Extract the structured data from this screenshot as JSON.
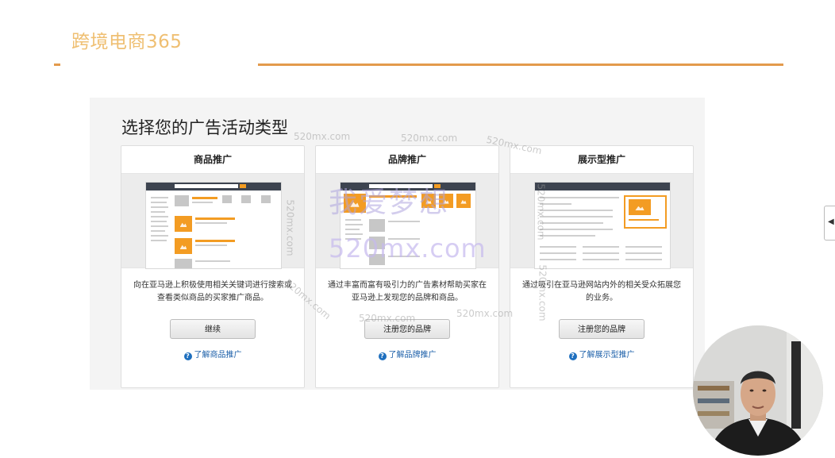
{
  "header": {
    "brand": "跨境电商365"
  },
  "page": {
    "title": "选择您的广告活动类型"
  },
  "cards": [
    {
      "title": "商品推广",
      "description": "向在亚马逊上积极使用相关关键词进行搜索或查看类似商品的买家推广商品。",
      "button": "继续",
      "learn_more": "了解商品推广"
    },
    {
      "title": "品牌推广",
      "description": "通过丰富而富有吸引力的广告素材帮助买家在亚马逊上发现您的品牌和商品。",
      "button": "注册您的品牌",
      "learn_more": "了解品牌推广"
    },
    {
      "title": "展示型推广",
      "description": "通过吸引在亚马逊网站内外的相关受众拓展您的业务。",
      "button": "注册您的品牌",
      "learn_more": "了解展示型推广"
    }
  ],
  "watermark": {
    "main": "我爱梦想",
    "domain": "520mx.com"
  },
  "help_icon_glyph": "?",
  "side_tab_glyph": "◀",
  "colors": {
    "brand": "#efbf72",
    "rule": "#e39a4c",
    "accent": "#f39c23",
    "link": "#1a5ea8"
  }
}
